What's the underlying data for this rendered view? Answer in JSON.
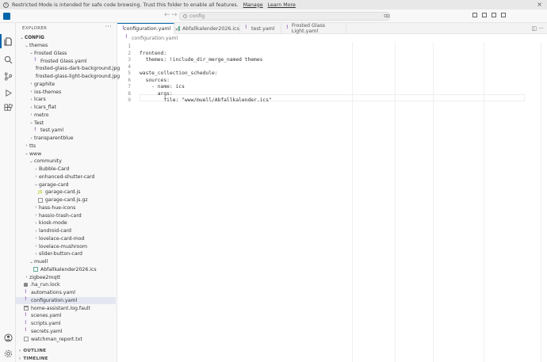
{
  "banner": {
    "message": "Restricted Mode is intended for safe code browsing. Trust this folder to enable all features.",
    "manage": "Manage",
    "learn_more": "Learn More",
    "close": "×"
  },
  "titlebar": {
    "search_value": "config",
    "back": "←",
    "forward": "→"
  },
  "explorer": {
    "title": "EXPLORER",
    "more": "···",
    "tree": [
      {
        "label": "CONFIG",
        "depth": 0,
        "kind": "folder-open",
        "bold": true
      },
      {
        "label": "themes",
        "depth": 1,
        "kind": "folder-open"
      },
      {
        "label": "Frosted Glass",
        "depth": 2,
        "kind": "folder-open"
      },
      {
        "label": "Frosted Glass.yaml",
        "depth": 3,
        "kind": "yaml"
      },
      {
        "label": "frosted-glass-dark-background.jpg",
        "depth": 3,
        "kind": "img"
      },
      {
        "label": "frosted-glass-light-background.jpg",
        "depth": 3,
        "kind": "img"
      },
      {
        "label": "graphite",
        "depth": 2,
        "kind": "folder"
      },
      {
        "label": "ios-themes",
        "depth": 2,
        "kind": "folder"
      },
      {
        "label": "lcars",
        "depth": 2,
        "kind": "folder"
      },
      {
        "label": "lcars_flat",
        "depth": 2,
        "kind": "folder"
      },
      {
        "label": "metro",
        "depth": 2,
        "kind": "folder"
      },
      {
        "label": "Test",
        "depth": 2,
        "kind": "folder-open"
      },
      {
        "label": "test.yaml",
        "depth": 3,
        "kind": "yaml"
      },
      {
        "label": "transparentblue",
        "depth": 2,
        "kind": "folder"
      },
      {
        "label": "tts",
        "depth": 1,
        "kind": "folder"
      },
      {
        "label": "www",
        "depth": 1,
        "kind": "folder-open"
      },
      {
        "label": "community",
        "depth": 2,
        "kind": "folder-open"
      },
      {
        "label": "Bubble-Card",
        "depth": 3,
        "kind": "folder"
      },
      {
        "label": "enhanced-shutter-card",
        "depth": 3,
        "kind": "folder"
      },
      {
        "label": "garage-card",
        "depth": 3,
        "kind": "folder-open"
      },
      {
        "label": "garage-card.js",
        "depth": 4,
        "kind": "js"
      },
      {
        "label": "garage-card.js.gz",
        "depth": 4,
        "kind": "txt"
      },
      {
        "label": "hass-hue-icons",
        "depth": 3,
        "kind": "folder"
      },
      {
        "label": "hassio-trash-card",
        "depth": 3,
        "kind": "folder"
      },
      {
        "label": "kiosk-mode",
        "depth": 3,
        "kind": "folder"
      },
      {
        "label": "landroid-card",
        "depth": 3,
        "kind": "folder"
      },
      {
        "label": "lovelace-card-mod",
        "depth": 3,
        "kind": "folder"
      },
      {
        "label": "lovelace-mushroom",
        "depth": 3,
        "kind": "folder"
      },
      {
        "label": "slider-button-card",
        "depth": 3,
        "kind": "folder"
      },
      {
        "label": "muell",
        "depth": 2,
        "kind": "folder-open"
      },
      {
        "label": "Abfallkalender2026.ics",
        "depth": 3,
        "kind": "ics"
      },
      {
        "label": "zigbee2mqtt",
        "depth": 1,
        "kind": "folder"
      },
      {
        "label": ".ha_run.lock",
        "depth": 1,
        "kind": "lock"
      },
      {
        "label": "automations.yaml",
        "depth": 1,
        "kind": "yaml"
      },
      {
        "label": "configuration.yaml",
        "depth": 1,
        "kind": "yaml",
        "selected": true
      },
      {
        "label": "home-assistant.log.fault",
        "depth": 1,
        "kind": "log"
      },
      {
        "label": "scenes.yaml",
        "depth": 1,
        "kind": "yaml"
      },
      {
        "label": "scripts.yaml",
        "depth": 1,
        "kind": "yaml"
      },
      {
        "label": "secrets.yaml",
        "depth": 1,
        "kind": "yaml"
      },
      {
        "label": "watchman_report.txt",
        "depth": 1,
        "kind": "txt"
      }
    ],
    "outline": "OUTLINE",
    "timeline": "TIMELINE"
  },
  "tabs": [
    {
      "label": "configuration.yaml",
      "active": true
    },
    {
      "label": "Abfallkalender2026.ics",
      "active": false
    },
    {
      "label": "test.yaml",
      "active": false
    },
    {
      "label": "Frosted Glass Light.yaml",
      "active": false
    }
  ],
  "breadcrumb": "configuration.yaml",
  "editor": {
    "lines": [
      {
        "n": "1",
        "text": ""
      },
      {
        "n": "2",
        "text": "frontend:"
      },
      {
        "n": "3",
        "text": "  themes: !include_dir_merge_named themes"
      },
      {
        "n": "4",
        "text": ""
      },
      {
        "n": "5",
        "text": "waste_collection_schedule:"
      },
      {
        "n": "6",
        "text": "  sources:"
      },
      {
        "n": "7",
        "text": "    - name: ics"
      },
      {
        "n": "8",
        "text": "      args:"
      },
      {
        "n": "9",
        "text": "        file: \"www/muell/Abfallkalender.ics\""
      }
    ]
  },
  "colors": {
    "accent": "#0065a9",
    "selection": "#e4e6f1"
  }
}
